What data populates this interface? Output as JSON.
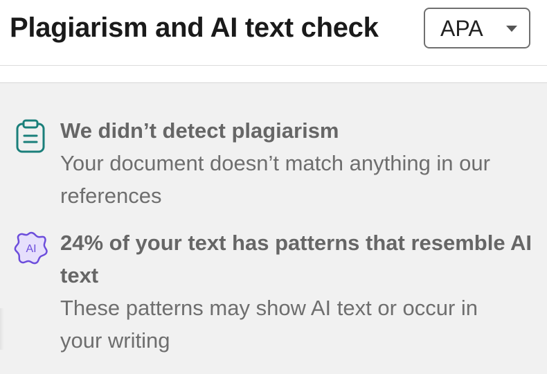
{
  "header": {
    "title": "Plagiarism and AI text check",
    "citation_style": {
      "selected": "APA",
      "icon": "chevron-down-icon"
    }
  },
  "results": [
    {
      "icon": "clipboard-icon",
      "heading": "We didn’t detect plagiarism",
      "description": "Your document doesn’t match anything in our references",
      "icon_color": "#1a7f7a"
    },
    {
      "icon": "ai-badge-icon",
      "heading": "24% of your text has patterns that resemble AI text",
      "description": "These patterns may show AI text or occur in your writing",
      "icon_label": "AI",
      "icon_color": "#6c4ddb",
      "icon_fill": "#e6dffc"
    }
  ],
  "colors": {
    "panel_background": "#f1f1f1",
    "heading_text": "#666666",
    "body_text": "#6e6e6e"
  }
}
